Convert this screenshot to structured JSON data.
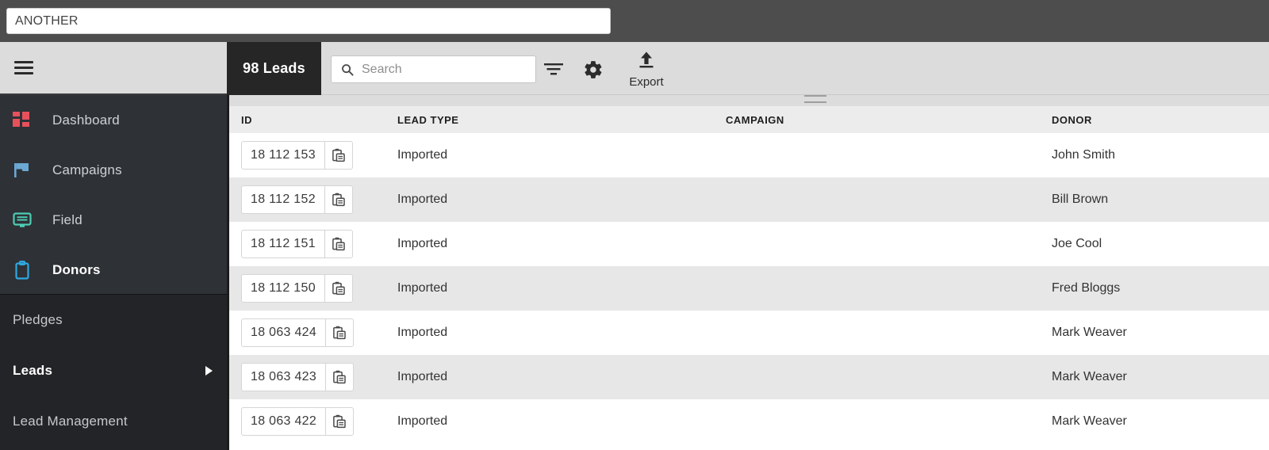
{
  "browser": {
    "url_value": "ANOTHER"
  },
  "sidebar": {
    "hamburger_icon": "hamburger-menu-icon",
    "primary": [
      {
        "label": "Dashboard",
        "icon": "dashboard-grid-icon",
        "color": "#e8505b",
        "active": false
      },
      {
        "label": "Campaigns",
        "icon": "flag-icon",
        "color": "#6ba8d4",
        "active": false
      },
      {
        "label": "Field",
        "icon": "field-form-icon",
        "color": "#4ecdb4",
        "active": false
      },
      {
        "label": "Donors",
        "icon": "clipboard-icon",
        "color": "#2fa8e0",
        "active": true
      }
    ],
    "secondary": [
      {
        "label": "Pledges",
        "active": false,
        "has_arrow": false
      },
      {
        "label": "Leads",
        "active": true,
        "has_arrow": true
      },
      {
        "label": "Lead Management",
        "active": false,
        "has_arrow": false
      }
    ]
  },
  "toolbar": {
    "tab_label": "98 Leads",
    "search": {
      "placeholder": "Search",
      "value": "",
      "icon": "search-icon"
    },
    "filter_icon": "filter-icon",
    "settings_icon": "gear-icon",
    "export": {
      "label": "Export",
      "icon": "upload-export-icon"
    },
    "drag_handle": "resize-drag-handle"
  },
  "table": {
    "columns": [
      "ID",
      "LEAD TYPE",
      "CAMPAIGN",
      "DONOR"
    ],
    "copy_icon": "copy-clipboard-icon",
    "rows": [
      {
        "id": "18 112 153",
        "lead_type": "Imported",
        "campaign": "",
        "donor": "John Smith"
      },
      {
        "id": "18 112 152",
        "lead_type": "Imported",
        "campaign": "",
        "donor": "Bill Brown"
      },
      {
        "id": "18 112 151",
        "lead_type": "Imported",
        "campaign": "",
        "donor": "Joe Cool"
      },
      {
        "id": "18 112 150",
        "lead_type": "Imported",
        "campaign": "",
        "donor": "Fred Bloggs"
      },
      {
        "id": "18 063 424",
        "lead_type": "Imported",
        "campaign": "",
        "donor": "Mark Weaver"
      },
      {
        "id": "18 063 423",
        "lead_type": "Imported",
        "campaign": "",
        "donor": "Mark Weaver"
      },
      {
        "id": "18 063 422",
        "lead_type": "Imported",
        "campaign": "",
        "donor": "Mark Weaver"
      }
    ]
  },
  "colors": {
    "topbar": "#4d4d4d",
    "sidebar_dark": "#222427",
    "sidebar_mid": "#2e3136",
    "toolbar_gray": "#dcdcdc",
    "tab_black": "#262626",
    "row_alt": "#e7e7e7",
    "header_row": "#ececec"
  }
}
